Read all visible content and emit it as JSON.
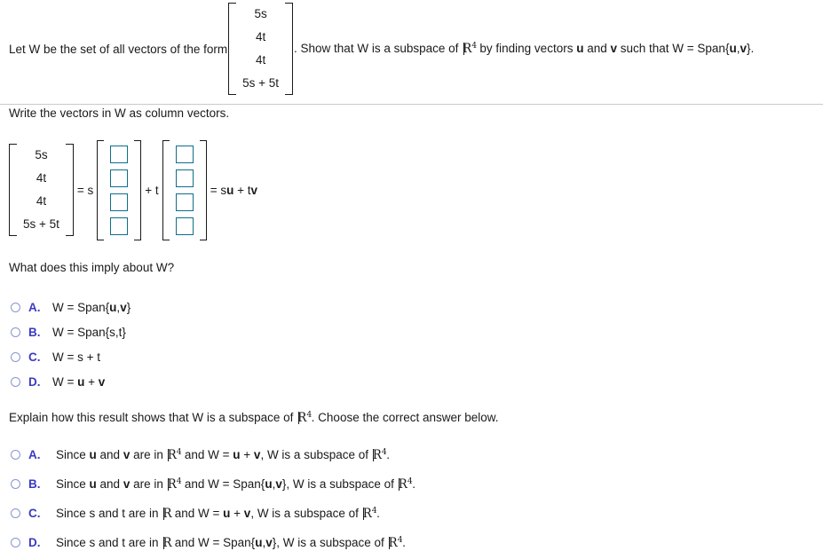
{
  "prompt": {
    "lead_text": "Let W be the set of all vectors of the form",
    "vector_rows": [
      "5s",
      "4t",
      "4t",
      "5s + 5t"
    ],
    "tail_1": ". Show that W is a subspace of ",
    "tail_field": "4",
    "tail_2": " by finding vectors ",
    "tail_u": "u",
    "tail_and": " and ",
    "tail_v": "v",
    "tail_3": " such that W = Span{",
    "tail_u2": "u",
    "tail_comma": ",",
    "tail_v2": "v",
    "tail_4": "}."
  },
  "instruction": "Write the vectors in W as column vectors.",
  "equation": {
    "lhs_rows": [
      "5s",
      "4t",
      "4t",
      "5s + 5t"
    ],
    "op_equals_s": "= s",
    "op_plus_t": "+ t",
    "result_eq": "= s",
    "result_u": "u",
    "result_plus": " + t",
    "result_v": "v",
    "u_boxes": [
      "",
      "",
      "",
      ""
    ],
    "v_boxes": [
      "",
      "",
      "",
      ""
    ],
    "box_placeholder": "",
    "box_border_color": "#0d6e8c"
  },
  "question1": {
    "text": "What does this imply about W?",
    "choices": [
      {
        "letter": "A.",
        "parts": [
          {
            "t": "W = Span{",
            "b": false
          },
          {
            "t": "u",
            "b": true
          },
          {
            "t": ",",
            "b": false
          },
          {
            "t": "v",
            "b": true
          },
          {
            "t": "}",
            "b": false
          }
        ]
      },
      {
        "letter": "B.",
        "parts": [
          {
            "t": "W = Span{s,t}",
            "b": false
          }
        ]
      },
      {
        "letter": "C.",
        "parts": [
          {
            "t": "W = s + t",
            "b": false
          }
        ]
      },
      {
        "letter": "D.",
        "parts": [
          {
            "t": "W = ",
            "b": false
          },
          {
            "t": "u",
            "b": true
          },
          {
            "t": " + ",
            "b": false
          },
          {
            "t": "v",
            "b": true
          }
        ]
      }
    ]
  },
  "question2": {
    "text_pre": "Explain how this result shows that W is a subspace of ",
    "text_exp": "4",
    "text_post": ". Choose the correct answer below.",
    "choices": [
      {
        "letter": "A.",
        "parts": [
          {
            "t": "Since ",
            "b": false
          },
          {
            "t": "u",
            "b": true
          },
          {
            "t": " and ",
            "b": false
          },
          {
            "t": "v",
            "b": true
          },
          {
            "t": " are in ",
            "b": false
          },
          {
            "r": "4"
          },
          {
            "t": " and W = ",
            "b": false
          },
          {
            "t": "u",
            "b": true
          },
          {
            "t": " + ",
            "b": false
          },
          {
            "t": "v",
            "b": true
          },
          {
            "t": ", W is a subspace of ",
            "b": false
          },
          {
            "r": "4"
          },
          {
            "t": ".",
            "b": false
          }
        ]
      },
      {
        "letter": "B.",
        "parts": [
          {
            "t": "Since ",
            "b": false
          },
          {
            "t": "u",
            "b": true
          },
          {
            "t": " and ",
            "b": false
          },
          {
            "t": "v",
            "b": true
          },
          {
            "t": " are in ",
            "b": false
          },
          {
            "r": "4"
          },
          {
            "t": " and W = Span{",
            "b": false
          },
          {
            "t": "u",
            "b": true
          },
          {
            "t": ",",
            "b": false
          },
          {
            "t": "v",
            "b": true
          },
          {
            "t": "}, W is a subspace of ",
            "b": false
          },
          {
            "r": "4"
          },
          {
            "t": ".",
            "b": false
          }
        ]
      },
      {
        "letter": "C.",
        "parts": [
          {
            "t": "Since s and t are in ",
            "b": false
          },
          {
            "r": ""
          },
          {
            "t": " and W = ",
            "b": false
          },
          {
            "t": "u",
            "b": true
          },
          {
            "t": " + ",
            "b": false
          },
          {
            "t": "v",
            "b": true
          },
          {
            "t": ", W is a subspace of ",
            "b": false
          },
          {
            "r": "4"
          },
          {
            "t": ".",
            "b": false
          }
        ]
      },
      {
        "letter": "D.",
        "parts": [
          {
            "t": "Since s and t are in ",
            "b": false
          },
          {
            "r": ""
          },
          {
            "t": " and W = Span{",
            "b": false
          },
          {
            "t": "u",
            "b": true
          },
          {
            "t": ",",
            "b": false
          },
          {
            "t": "v",
            "b": true
          },
          {
            "t": "}, W is a subspace of ",
            "b": false
          },
          {
            "r": "4"
          },
          {
            "t": ".",
            "b": false
          }
        ]
      }
    ]
  },
  "colors": {
    "input_border": "#0d6e8c",
    "choice_letter": "#3a3ac2",
    "radio_border": "#8a94d2",
    "divider": "#c9c9c9",
    "text": "#1a1a1a"
  }
}
